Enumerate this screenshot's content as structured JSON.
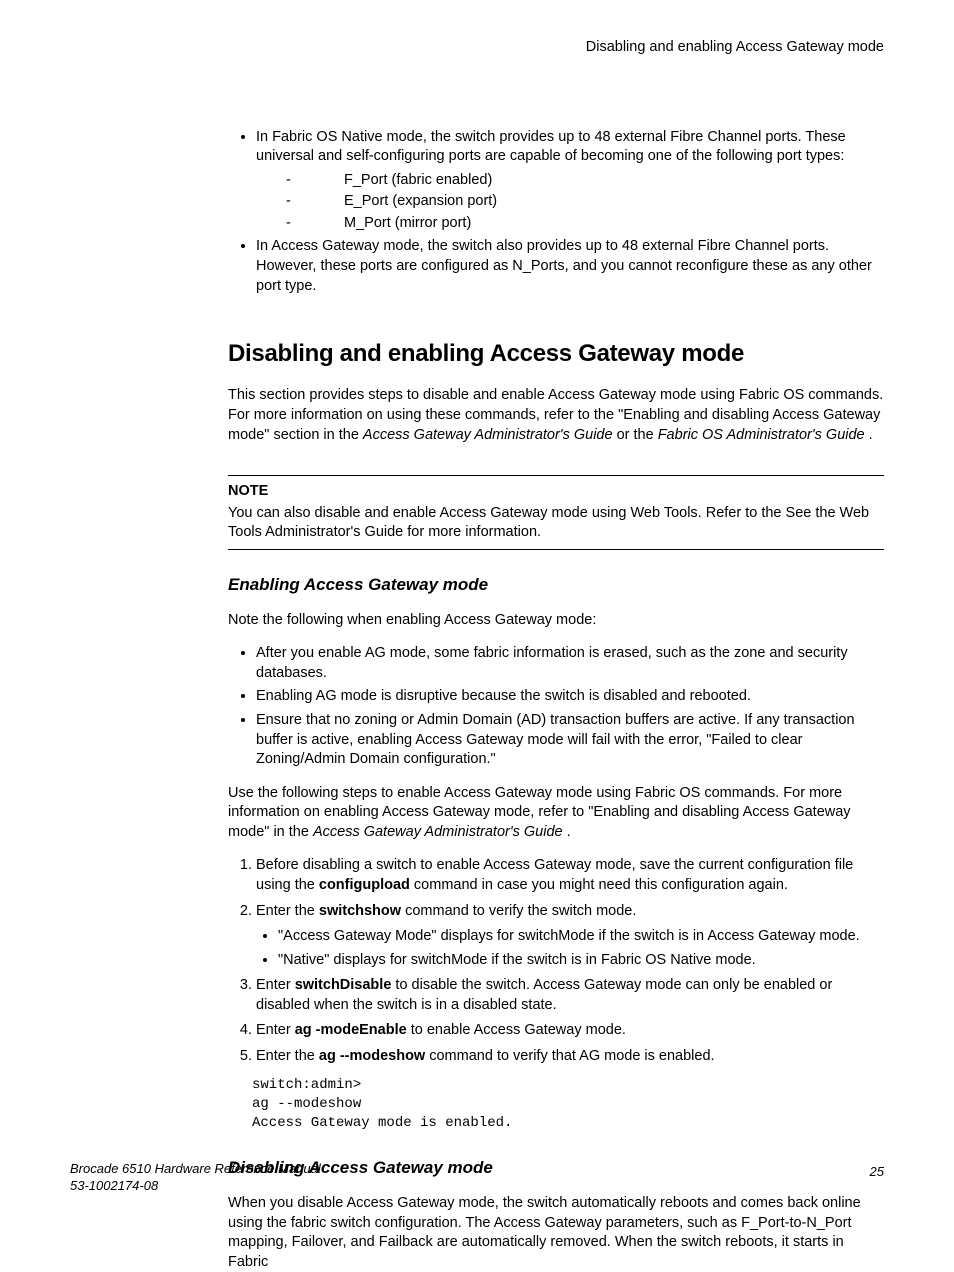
{
  "header": {
    "running_title": "Disabling and enabling Access Gateway mode"
  },
  "intro_list": {
    "item1": "In Fabric OS Native mode, the switch provides up to 48 external Fibre Channel ports. These universal and self-configuring ports are capable of becoming one of the following port types:",
    "sub1": "F_Port (fabric enabled)",
    "sub2": "E_Port (expansion port)",
    "sub3": "M_Port (mirror port)",
    "item2": "In Access Gateway mode, the switch also provides up to 48 external Fibre Channel ports. However, these ports are configured as N_Ports, and you cannot reconfigure these as any other port type."
  },
  "section": {
    "title": "Disabling and enabling Access Gateway mode",
    "para_pre": "This section provides steps to disable and enable Access Gateway mode using Fabric OS commands. For more information on using these commands, refer to the \"Enabling and disabling Access Gateway mode\" section in the ",
    "ref1": "Access Gateway Administrator's Guide",
    "mid": " or the ",
    "ref2": "Fabric OS Administrator's Guide",
    "tail": " ."
  },
  "note": {
    "label": "NOTE",
    "body": "You can also disable and enable Access Gateway mode using Web Tools. Refer to the See the Web Tools Administrator's Guide for more information."
  },
  "enable": {
    "title": "Enabling Access Gateway mode",
    "lead": "Note the following when enabling Access Gateway mode:",
    "b1": "After you enable AG mode, some fabric information is erased, such as the zone and security databases.",
    "b2": "Enabling AG mode is disruptive because the switch is disabled and rebooted.",
    "b3": "Ensure that no zoning or Admin Domain (AD) transaction buffers are active. If any transaction buffer is active, enabling Access Gateway mode will fail with the error, \"Failed to clear Zoning/Admin Domain configuration.\"",
    "para2_pre": "Use the following steps to enable Access Gateway mode using Fabric OS commands. For more information on enabling Access Gateway mode, refer to \"Enabling and disabling Access Gateway mode\" in the ",
    "para2_ref": "Access Gateway Administrator's Guide",
    "para2_tail": " .",
    "steps": {
      "s1_pre": "Before disabling a switch to enable Access Gateway mode, save the current configuration file using the ",
      "s1_cmd": "configupload",
      "s1_post": " command in case you might need this configuration again.",
      "s2_pre": "Enter the ",
      "s2_cmd": "switchshow",
      "s2_post": " command to verify the switch mode.",
      "s2_sub1": "\"Access Gateway Mode\" displays for switchMode if the switch is in Access Gateway mode.",
      "s2_sub2": "\"Native\" displays for switchMode if the switch is in Fabric OS Native mode.",
      "s3_pre": "Enter ",
      "s3_cmd": "switchDisable",
      "s3_post": " to disable the switch. Access Gateway mode can only be enabled or disabled when the switch is in a disabled state.",
      "s4_pre": "Enter ",
      "s4_cmd": "ag ‑modeEnable",
      "s4_post": " to enable Access Gateway mode.",
      "s5_pre": "Enter the ",
      "s5_cmd": "ag --modeshow",
      "s5_post": " command to verify that AG mode is enabled."
    },
    "terminal": "switch:admin>\nag --modeshow\nAccess Gateway mode is enabled."
  },
  "disable": {
    "title": "Disabling Access Gateway mode",
    "para": "When you disable Access Gateway mode, the switch automatically reboots and comes back online using the fabric switch configuration. The Access Gateway parameters, such as F_Port-to-N_Port mapping, Failover, and Failback are automatically removed. When the switch reboots, it starts in Fabric"
  },
  "footer": {
    "title": "Brocade 6510 Hardware Reference Manual",
    "docnum": "53-1002174-08",
    "page": "25"
  }
}
